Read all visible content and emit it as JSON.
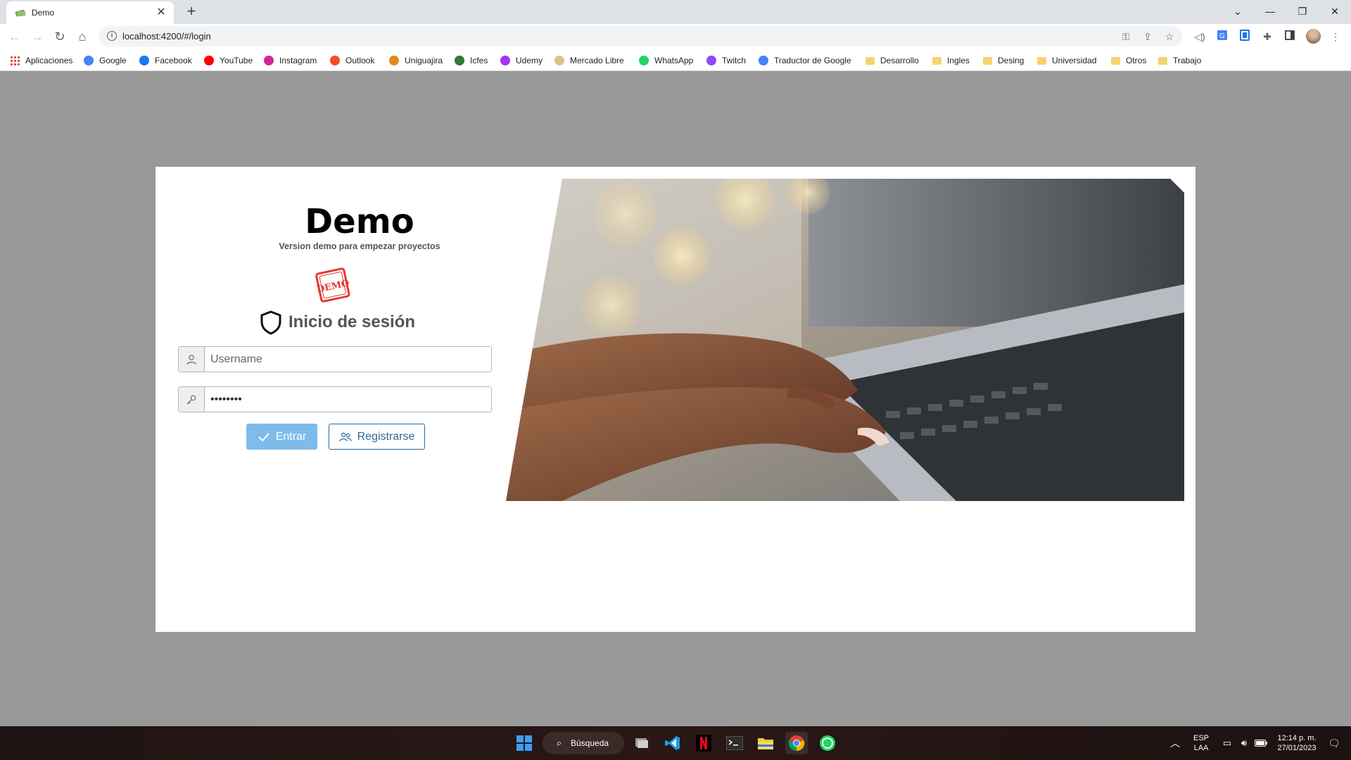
{
  "browser": {
    "tab_title": "Demo",
    "new_tab_label": "+",
    "url": "localhost:4200/#/login",
    "bookmarks": [
      {
        "label": "Aplicaciones",
        "icon": "apps-grid-icon",
        "color": "#ea4335"
      },
      {
        "label": "Google",
        "icon": "google-icon",
        "color": "#4285f4"
      },
      {
        "label": "Facebook",
        "icon": "facebook-icon",
        "color": "#1877f2"
      },
      {
        "label": "YouTube",
        "icon": "youtube-icon",
        "color": "#ff0000"
      },
      {
        "label": "Instagram",
        "icon": "instagram-icon",
        "color": "#d6249f"
      },
      {
        "label": "Outlook",
        "icon": "microsoft-icon",
        "color": "#f25022"
      },
      {
        "label": "Uniguajira",
        "icon": "uniguajira-icon",
        "color": "#e08a1e"
      },
      {
        "label": "Icfes",
        "icon": "icfes-icon",
        "color": "#2e7d32"
      },
      {
        "label": "Udemy",
        "icon": "udemy-icon",
        "color": "#a435f0"
      },
      {
        "label": "Mercado Libre",
        "icon": "mercadolibre-icon",
        "color": "#d8c48b"
      },
      {
        "label": "WhatsApp",
        "icon": "whatsapp-icon",
        "color": "#25d366"
      },
      {
        "label": "Twitch",
        "icon": "twitch-icon",
        "color": "#9146ff"
      },
      {
        "label": "Traductor de Google",
        "icon": "translate-icon",
        "color": "#4285f4"
      },
      {
        "label": "Desarrollo",
        "icon": "folder-icon",
        "color": "#f6d36d"
      },
      {
        "label": "Ingles",
        "icon": "folder-icon",
        "color": "#f6d36d"
      },
      {
        "label": "Desing",
        "icon": "folder-icon",
        "color": "#f6d36d"
      },
      {
        "label": "Universidad",
        "icon": "folder-icon",
        "color": "#f6d36d"
      },
      {
        "label": "Otros",
        "icon": "folder-icon",
        "color": "#f6d36d"
      },
      {
        "label": "Trabajo",
        "icon": "folder-icon",
        "color": "#f6d36d"
      }
    ]
  },
  "login": {
    "title": "Demo",
    "subtitle": "Version demo para empezar proyectos",
    "stamp_text": "DEMO",
    "heading": "Inicio de sesión",
    "username_placeholder": "Username",
    "username_value": "",
    "password_value": "12345678",
    "login_button": "Entrar",
    "register_button": "Registrarse",
    "colors": {
      "primary_button": "#7dbcea",
      "outline_button": "#2b6a97",
      "stamp": "#e53935"
    }
  },
  "taskbar": {
    "search_label": "Búsqueda",
    "language_top": "ESP",
    "language_bottom": "LAA",
    "time": "12:14 p. m.",
    "date": "27/01/2023"
  }
}
